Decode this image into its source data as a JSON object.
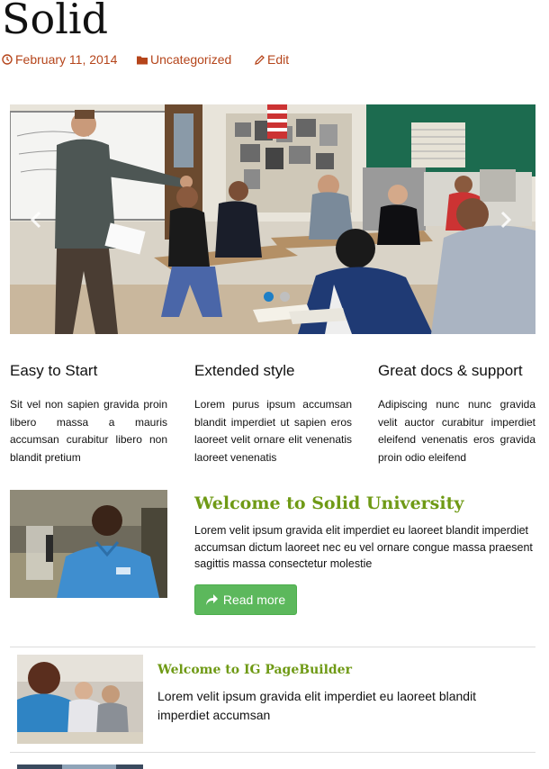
{
  "post": {
    "title": "Solid",
    "date": "February 11, 2014",
    "category": "Uncategorized",
    "edit_label": "Edit"
  },
  "slider": {
    "prev_icon": "chevron-left-icon",
    "next_icon": "chevron-right-icon",
    "slide_count": 2,
    "active_slide": 1
  },
  "features": [
    {
      "title": "Easy to Start",
      "text": "Sit vel non sapien gravida proin libero massa a mauris accumsan curabitur libero non blandit pretium"
    },
    {
      "title": "Extended style",
      "text": "Lorem purus ipsum accumsan blandit imperdiet ut sapien eros laoreet velit ornare elit venenatis laoreet venenatis"
    },
    {
      "title": "Great docs & support",
      "text": "Adipiscing nunc nunc gravida velit auctor curabitur imperdiet eleifend venenatis eros gravida proin odio eleifend"
    }
  ],
  "welcome": {
    "title": "Welcome to Solid University",
    "text": "Lorem velit ipsum gravida elit imperdiet eu laoreet blandit imperdiet accumsan dictum laoreet nec eu vel ornare congue massa praesent sagittis massa consectetur molestie",
    "button_label": "Read more"
  },
  "ig": {
    "title": "Welcome to IG PageBuilder",
    "text": "Lorem velit ipsum gravida elit imperdiet eu laoreet blandit imperdiet accumsan"
  },
  "colors": {
    "meta": "#b5451b",
    "accent_green": "#6f9a15",
    "button": "#5cb85c",
    "slider_dot_active": "#1e7fc6"
  }
}
